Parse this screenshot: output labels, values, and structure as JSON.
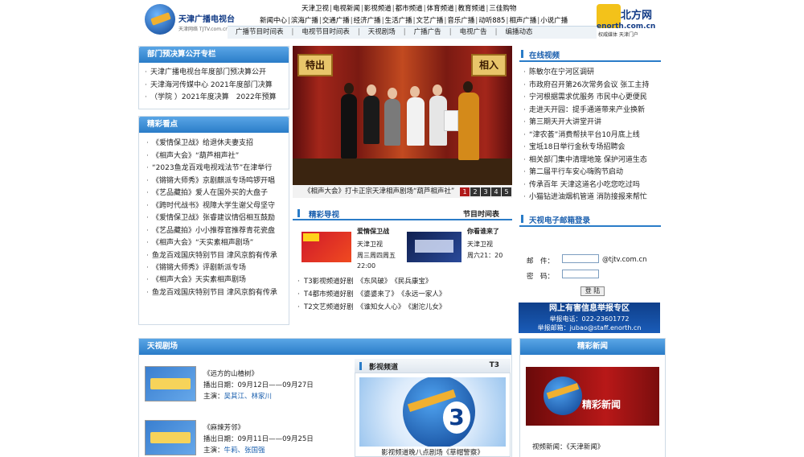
{
  "header": {
    "logo_name": "天津广播电视台",
    "logo_url": "天津网络 TJTV.com.cn",
    "nav_row1": [
      "天津卫视",
      "电视新闻",
      "影视频道",
      "都市频道",
      "体育频道",
      "教育频道",
      "三佳购物"
    ],
    "nav_row2": [
      "新闻中心",
      "滨海广播",
      "交通广播",
      "经济广播",
      "生活广播",
      "文艺广播",
      "音乐广播",
      "动听885",
      "相声广播",
      "小说广播"
    ],
    "subnav": [
      "广播节目时间表",
      "电视节目时间表",
      "天视剧场",
      "广播广告",
      "电视广告",
      "编播动态"
    ],
    "enorth_name": "北方网",
    "enorth_url": "enorth.com.cn",
    "enorth_slogan": "权威媒体  天津门户"
  },
  "budget": {
    "title": "部门预决算公开专栏",
    "items": [
      "天津广播电视台年度部门预决算公开",
      "天津海河传媒中心 2021年度部门决算",
      "（学院 ）2021年度决算　2022年预算"
    ]
  },
  "highlights": {
    "title": "精彩看点",
    "items": [
      "《爱情保卫战》给退休夫妻支招",
      "《相声大会》“葫芦相声社”",
      "“2023鱼龙百戏电视戏法节”在津举行",
      "《锵锵大师秀》京剧麒派专场鸣锣开唱",
      "《艺品藏拍》爱人在国外买的大盘子",
      "《跨时代战书》视障大学生谢父母坚守",
      "《爱情保卫战》张睿建议情侣相互鼓励",
      "《艺品藏拍》小小推荐官推荐青花瓷盘",
      "《相声大会》“天实素相声剧场”",
      "鱼龙百戏国庆特别节目 津风京韵有传承",
      "《锵锵大师秀》评剧新派专场",
      "《相声大会》天实素相声剧场",
      "鱼龙百戏国庆特别节目 津风京韵有传承"
    ]
  },
  "photo": {
    "plaque_left": "特出",
    "plaque_right": "相入",
    "caption": "《相声大会》打卡正宗天津相声剧场“葫芦相声社”",
    "pages": [
      "1",
      "2",
      "3",
      "4",
      "5"
    ]
  },
  "guide": {
    "title": "精彩导视",
    "right": "节目时间表",
    "show1": {
      "name": "爱情保卫战",
      "channel": "天津卫视",
      "time1": "周三周四周五",
      "time2": "22:00"
    },
    "show2": {
      "name": "你看谁来了",
      "channel": "天津卫视",
      "time1": "周六21：20"
    },
    "lines": [
      [
        "T3影视频道好剧",
        "《东风破》",
        "《民兵康宝》"
      ],
      [
        "T4都市频道好剧",
        "《婆婆来了》",
        "《永远一家人》"
      ],
      [
        "T2文艺频道好剧",
        "《谁知女人心》",
        "《謝沱儿女》"
      ]
    ]
  },
  "online": {
    "title": "在线视频",
    "items": [
      "陈敏尔在宁河区调研",
      "市政府召开第26次常务会议 张工主持",
      "宁河根据需求优服务 市民中心更便民",
      "走进天开园：提手通道带来产业换新",
      "第三期天开大讲堂开讲",
      "“津农荟”消费帮扶平台10月底上线",
      "宝坻18日举行金秋专场招聘会",
      "相关部门集中清理地笼 保护河道生态",
      "第二届平行车安心嗨购节启动",
      "传承百年 天津这道名小吃您吃过吗",
      "小猫钻进油烟机管道 消防接报来帮忙"
    ]
  },
  "mail": {
    "title": "天视电子邮箱登录",
    "email_label": "邮　件：",
    "domain": "@tjtv.com.cn",
    "password_label": "密　码：",
    "login": "登 陆"
  },
  "report": {
    "title": "网上有害信息举报专区",
    "phone": "举报电话：022-23601772",
    "email": "举报邮箱：jubao@staff.enorth.cn"
  },
  "theater": {
    "title": "天视剧场",
    "dramas": [
      {
        "name": "《远方的山楂树》",
        "date": "播出日期：09月12日——09月27日",
        "cast_label": "主演：",
        "cast": "吴其江、林家川"
      },
      {
        "name": "《麻辣芳邻》",
        "date": "播出日期：09月11日——09月25日",
        "cast_label": "主演：",
        "cast": "牛莉、张国强"
      }
    ]
  },
  "movie_channel": {
    "title": "影视频道",
    "code": "T3",
    "logo_text": "3",
    "caption": "影视频道晚八点剧场《草帽警察》"
  },
  "featured_news": {
    "title": "精彩新闻",
    "image_text": "精彩新闻",
    "caption": "视频新闻：《天津新闻》"
  },
  "colors": {
    "brand_blue": "#2a7cc8",
    "header_blue": "#123b86",
    "accent_red": "#b01a1a"
  }
}
